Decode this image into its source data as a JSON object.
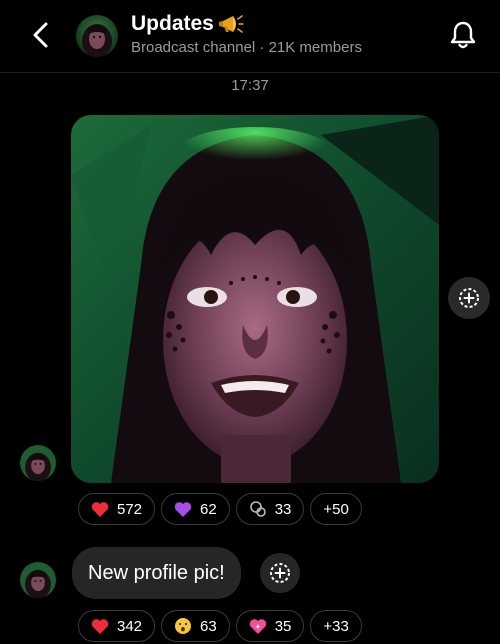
{
  "header": {
    "title": "Updates",
    "title_emoji": "megaphone-icon",
    "subtitle": "Broadcast channel · 21K members",
    "back_icon": "chevron-left-icon",
    "bell_icon": "bell-icon"
  },
  "timestamp": "17:37",
  "post": {
    "image_description_icon": "profile-photo",
    "side_action_icon": "add-circle-icon",
    "reactions": [
      {
        "emoji": "red-heart-icon",
        "count": "572"
      },
      {
        "emoji": "purple-heart-icon",
        "count": "62"
      },
      {
        "emoji": "reaction-icon",
        "count": "33"
      },
      {
        "count": "+50"
      }
    ]
  },
  "message": {
    "text": "New profile pic!",
    "action_icon": "add-circle-icon",
    "reactions": [
      {
        "emoji": "red-heart-icon",
        "count": "342"
      },
      {
        "emoji": "surprised-face-icon",
        "count": "63"
      },
      {
        "emoji": "sparkling-heart-icon",
        "count": "35"
      },
      {
        "count": "+33"
      }
    ]
  },
  "colors": {
    "background": "#000000",
    "bubble": "#262626",
    "secondary_text": "#9b9b9b"
  }
}
